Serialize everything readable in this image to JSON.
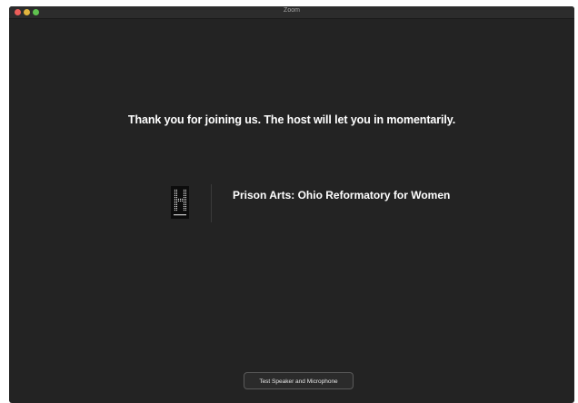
{
  "window": {
    "title": "Zoom"
  },
  "main": {
    "waiting_message": "Thank you for joining us. The host will let you in momentarily.",
    "meeting_title": "Prison Arts: Ohio Reformatory for Women",
    "logo_icon": "harmony-h-logo-icon",
    "test_button_label": "Test Speaker and Microphone"
  },
  "colors": {
    "background": "#232323",
    "text": "#ffffff",
    "close": "#ec5e5a",
    "minimize": "#e2b53e",
    "maximize": "#5fc24f"
  }
}
